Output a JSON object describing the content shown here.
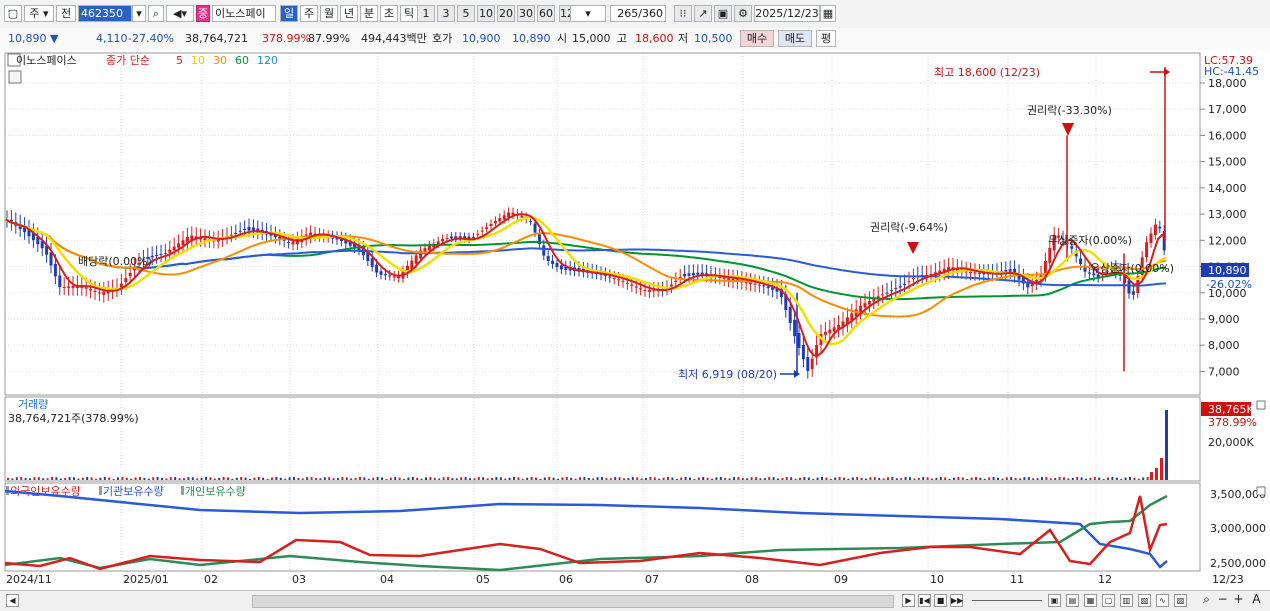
{
  "toolbar": {
    "type1": "주",
    "type2": "전",
    "code": "462350",
    "stock_badge": "증",
    "stock_name": "이노스페이",
    "periods": [
      "일",
      "주",
      "월",
      "년",
      "분",
      "초",
      "틱"
    ],
    "active_period": "일",
    "ticks": [
      "1",
      "3",
      "5",
      "10",
      "20",
      "30",
      "60",
      "120"
    ],
    "count": "265",
    "count_total": "/360",
    "date": "2025/12/23"
  },
  "quote": {
    "price": "10,890",
    "change": "4,110",
    "change_pct": "-27.40%",
    "volume": "38,764,721",
    "volume_pct": "378.99%",
    "ratio": "87.99%",
    "amount": "494,443백만",
    "hoga_label": "호가",
    "ask": "10,900",
    "bid": "10,890",
    "open_label": "시",
    "open": "15,000",
    "high_label": "고",
    "high": "18,600",
    "low_label": "저",
    "low": "10,500",
    "buy": "매수",
    "sell": "매도",
    "eval": "평"
  },
  "legend": {
    "name": "이노스페이스",
    "series": "종가 단순",
    "ma": [
      {
        "label": "5",
        "color": "#d81e1e"
      },
      {
        "label": "10",
        "color": "#f0c800"
      },
      {
        "label": "30",
        "color": "#ff8c00"
      },
      {
        "label": "60",
        "color": "#00962d"
      },
      {
        "label": "120",
        "color": "#1e8ccd"
      }
    ]
  },
  "price_axis": {
    "labels": [
      "18,000",
      "17,000",
      "16,000",
      "15,000",
      "14,000",
      "13,000",
      "12,000",
      "11,000",
      "10,000",
      "9,000",
      "8,000",
      "7,000"
    ],
    "lc": "LC:57.39",
    "hc": "HC:-41.45",
    "current": "10,890",
    "current_pct": "-26.02%"
  },
  "annotations": {
    "high": "최고 18,600 (12/23)",
    "low": "최저 6,919 (08/20)",
    "rights1": "권리락(-33.30%)",
    "rights2": "권리락(-9.64%)",
    "dividend": "배당락(0.00%)",
    "cap1": "무상증자(0.00%)",
    "cap2": "유상증자(0.00%)"
  },
  "volume_panel": {
    "title": "거래량",
    "value": "38,764,721주(378.99%)",
    "tag": "38,765K",
    "tag_pct": "378.99%",
    "axis": "20,000K"
  },
  "holdings_panel": {
    "series": [
      {
        "label": "외국인보유수량",
        "color": "#d81e1e"
      },
      {
        "label": "기관보유수량",
        "color": "#2a5ad8"
      },
      {
        "label": "개인보유수량",
        "color": "#2e8b57"
      }
    ],
    "axis": [
      "3,500,000",
      "3,000,000",
      "2,500,000"
    ]
  },
  "x_axis": [
    "2024/11",
    "2025/01",
    "02",
    "03",
    "04",
    "05",
    "06",
    "07",
    "08",
    "09",
    "10",
    "11",
    "12",
    "12/23"
  ],
  "chart_data": [
    {
      "type": "line",
      "title": "이노스페이스",
      "x": [
        "2024/11",
        "2024/12",
        "2025/01",
        "2025/02",
        "2025/03",
        "2025/04",
        "2025/05",
        "2025/06",
        "2025/07",
        "2025/08",
        "2025/09",
        "2025/10",
        "2025/11",
        "2025/12",
        "12/23"
      ],
      "series": [
        {
          "name": "종가",
          "values": [
            12800,
            11600,
            10000,
            12000,
            12500,
            11000,
            12500,
            13000,
            10700,
            10100,
            7000,
            9800,
            10800,
            11000,
            10890
          ]
        }
      ],
      "ylim": [
        6500,
        18600
      ],
      "annotations": [
        "최고 18,600 (12/23)",
        "최저 6,919 (08/20)"
      ]
    },
    {
      "type": "bar",
      "title": "거래량",
      "series": [
        {
          "name": "거래량",
          "values": [
            38764721
          ]
        }
      ]
    }
  ]
}
